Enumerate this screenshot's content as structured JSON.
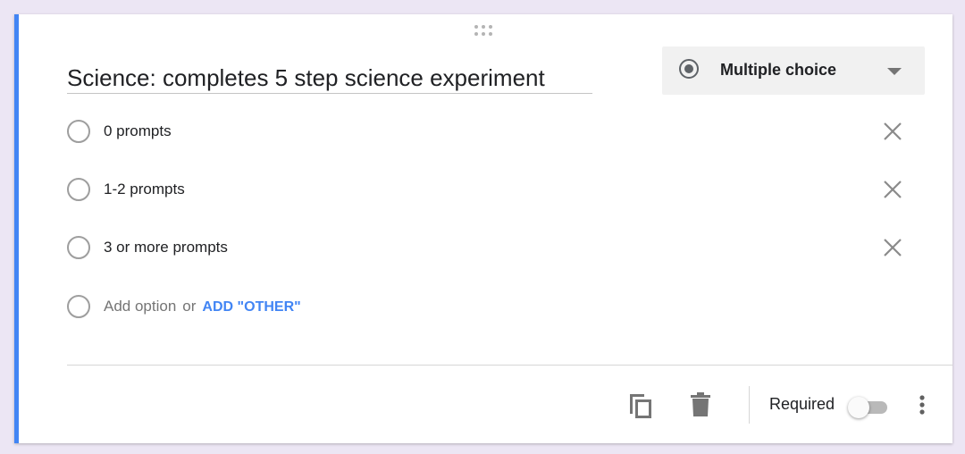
{
  "question": {
    "title": "Science: completes 5 step science experiment",
    "type_label": "Multiple choice"
  },
  "options": [
    {
      "label": "0 prompts"
    },
    {
      "label": "1-2 prompts"
    },
    {
      "label": "3 or more prompts"
    }
  ],
  "add_option": {
    "label": "Add option",
    "or": "or",
    "other_label": "ADD \"OTHER\""
  },
  "footer": {
    "required_label": "Required",
    "required_on": false
  },
  "colors": {
    "accent": "#4285f4",
    "link": "#4285f4"
  },
  "icons": [
    "drag-handle-icon",
    "radio-icon",
    "dropdown-arrow-icon",
    "close-icon",
    "duplicate-icon",
    "delete-icon",
    "more-vert-icon"
  ]
}
